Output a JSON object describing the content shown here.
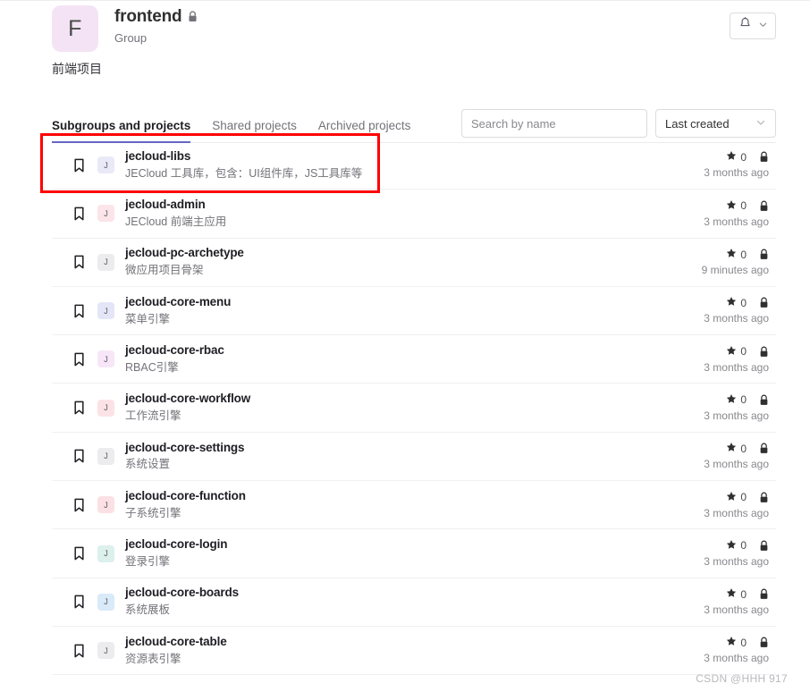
{
  "header": {
    "avatar_letter": "F",
    "avatar_color": "#f4e3f5",
    "title": "frontend",
    "subtitle": "Group",
    "lock_icon": "lock-icon",
    "description": "前端项目",
    "notification": {
      "bell_icon": "bell-icon",
      "chevron_icon": "chevron-down-icon"
    }
  },
  "tabs": [
    {
      "label": "Subgroups and projects",
      "active": true
    },
    {
      "label": "Shared projects",
      "active": false
    },
    {
      "label": "Archived projects",
      "active": false
    }
  ],
  "filters": {
    "search_placeholder": "Search by name",
    "search_value": "",
    "sort_label": "Last created",
    "sort_chevron_icon": "chevron-down-icon"
  },
  "accent_color": "#6666c4",
  "highlight_color": "#ff0000",
  "projects": [
    {
      "name": "jecloud-libs",
      "description": "JECloud 工具库，包含：UI组件库，JS工具库等",
      "avatar_letter": "J",
      "avatar_color": "#e9e9f7",
      "stars": "0",
      "visibility_icon": "lock-icon",
      "updated": "3 months ago",
      "highlighted": true
    },
    {
      "name": "jecloud-admin",
      "description": "JECloud 前端主应用",
      "avatar_letter": "J",
      "avatar_color": "#fbe5e8",
      "stars": "0",
      "visibility_icon": "lock-icon",
      "updated": "3 months ago",
      "highlighted": false
    },
    {
      "name": "jecloud-pc-archetype",
      "description": "微应用项目骨架",
      "avatar_letter": "J",
      "avatar_color": "#ececee",
      "stars": "0",
      "visibility_icon": "lock-icon",
      "updated": "9 minutes ago",
      "highlighted": false
    },
    {
      "name": "jecloud-core-menu",
      "description": "菜单引擎",
      "avatar_letter": "J",
      "avatar_color": "#e4e6f7",
      "stars": "0",
      "visibility_icon": "lock-icon",
      "updated": "3 months ago",
      "highlighted": false
    },
    {
      "name": "jecloud-core-rbac",
      "description": "RBAC引擎",
      "avatar_letter": "J",
      "avatar_color": "#f7e6f7",
      "stars": "0",
      "visibility_icon": "lock-icon",
      "updated": "3 months ago",
      "highlighted": false
    },
    {
      "name": "jecloud-core-workflow",
      "description": "工作流引擎",
      "avatar_letter": "J",
      "avatar_color": "#fbe3e5",
      "stars": "0",
      "visibility_icon": "lock-icon",
      "updated": "3 months ago",
      "highlighted": false
    },
    {
      "name": "jecloud-core-settings",
      "description": "系统设置",
      "avatar_letter": "J",
      "avatar_color": "#ececee",
      "stars": "0",
      "visibility_icon": "lock-icon",
      "updated": "3 months ago",
      "highlighted": false
    },
    {
      "name": "jecloud-core-function",
      "description": "子系统引擎",
      "avatar_letter": "J",
      "avatar_color": "#fbe1e4",
      "stars": "0",
      "visibility_icon": "lock-icon",
      "updated": "3 months ago",
      "highlighted": false
    },
    {
      "name": "jecloud-core-login",
      "description": "登录引擎",
      "avatar_letter": "J",
      "avatar_color": "#dcf0ec",
      "stars": "0",
      "visibility_icon": "lock-icon",
      "updated": "3 months ago",
      "highlighted": false
    },
    {
      "name": "jecloud-core-boards",
      "description": "系统展板",
      "avatar_letter": "J",
      "avatar_color": "#d9eaf8",
      "stars": "0",
      "visibility_icon": "lock-icon",
      "updated": "3 months ago",
      "highlighted": false
    },
    {
      "name": "jecloud-core-table",
      "description": "资源表引擎",
      "avatar_letter": "J",
      "avatar_color": "#ececee",
      "stars": "0",
      "visibility_icon": "lock-icon",
      "updated": "3 months ago",
      "highlighted": false
    }
  ],
  "watermark": "CSDN @HHH 917"
}
